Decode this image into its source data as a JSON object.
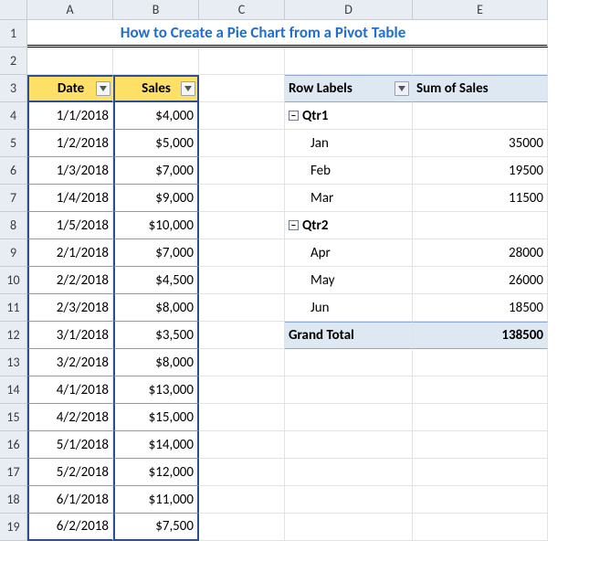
{
  "columns": [
    "A",
    "B",
    "C",
    "D",
    "E"
  ],
  "row_numbers": [
    1,
    2,
    3,
    4,
    5,
    6,
    7,
    8,
    9,
    10,
    11,
    12,
    13,
    14,
    15,
    16,
    17,
    18,
    19
  ],
  "title": "How to Create a Pie Chart from a Pivot Table",
  "data_table": {
    "headers": {
      "date": "Date",
      "sales": "Sales"
    },
    "rows": [
      {
        "date": "1/1/2018",
        "sales": "$4,000"
      },
      {
        "date": "1/2/2018",
        "sales": "$5,000"
      },
      {
        "date": "1/3/2018",
        "sales": "$7,000"
      },
      {
        "date": "1/4/2018",
        "sales": "$9,000"
      },
      {
        "date": "1/5/2018",
        "sales": "$10,000"
      },
      {
        "date": "2/1/2018",
        "sales": "$7,000"
      },
      {
        "date": "2/2/2018",
        "sales": "$4,500"
      },
      {
        "date": "2/3/2018",
        "sales": "$8,000"
      },
      {
        "date": "3/1/2018",
        "sales": "$3,500"
      },
      {
        "date": "3/2/2018",
        "sales": "$8,000"
      },
      {
        "date": "4/1/2018",
        "sales": "$13,000"
      },
      {
        "date": "4/2/2018",
        "sales": "$15,000"
      },
      {
        "date": "5/1/2018",
        "sales": "$14,000"
      },
      {
        "date": "5/2/2018",
        "sales": "$12,000"
      },
      {
        "date": "6/1/2018",
        "sales": "$11,000"
      },
      {
        "date": "6/2/2018",
        "sales": "$7,500"
      }
    ]
  },
  "pivot": {
    "row_labels_header": "Row Labels",
    "values_header": "Sum of Sales",
    "groups": [
      {
        "label": "Qtr1",
        "items": [
          {
            "label": "Jan",
            "value": "35000"
          },
          {
            "label": "Feb",
            "value": "19500"
          },
          {
            "label": "Mar",
            "value": "11500"
          }
        ]
      },
      {
        "label": "Qtr2",
        "items": [
          {
            "label": "Apr",
            "value": "28000"
          },
          {
            "label": "May",
            "value": "26000"
          },
          {
            "label": "Jun",
            "value": "18500"
          }
        ]
      }
    ],
    "grand_total_label": "Grand Total",
    "grand_total_value": "138500"
  }
}
